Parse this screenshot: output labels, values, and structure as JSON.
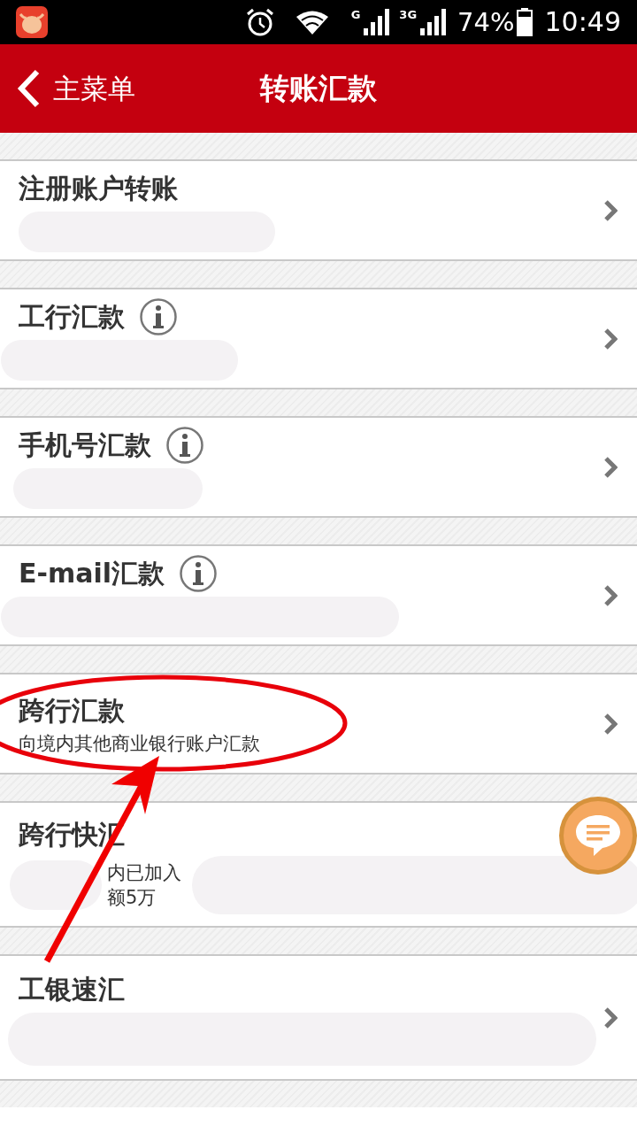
{
  "status_bar": {
    "network_1": "G",
    "network_2": "3G",
    "battery": "74%",
    "time": "10:49"
  },
  "header": {
    "back": "主菜单",
    "title": "转账汇款"
  },
  "items": [
    {
      "title": "注册账户转账",
      "info": false,
      "chevron": true
    },
    {
      "title": "工行汇款",
      "info": true,
      "chevron": true
    },
    {
      "title": "手机号汇款",
      "info": true,
      "chevron": true
    },
    {
      "title": "E-mail汇款",
      "info": true,
      "chevron": true
    },
    {
      "title": "跨行汇款",
      "info": false,
      "chevron": true,
      "lines": [
        "向境内其他商业银行账户汇款"
      ]
    },
    {
      "title": "跨行快汇",
      "info": false,
      "chevron": false,
      "lines": [
        "内已加入",
        "额5万"
      ]
    },
    {
      "title": "工银速汇",
      "info": false,
      "chevron": true
    }
  ]
}
